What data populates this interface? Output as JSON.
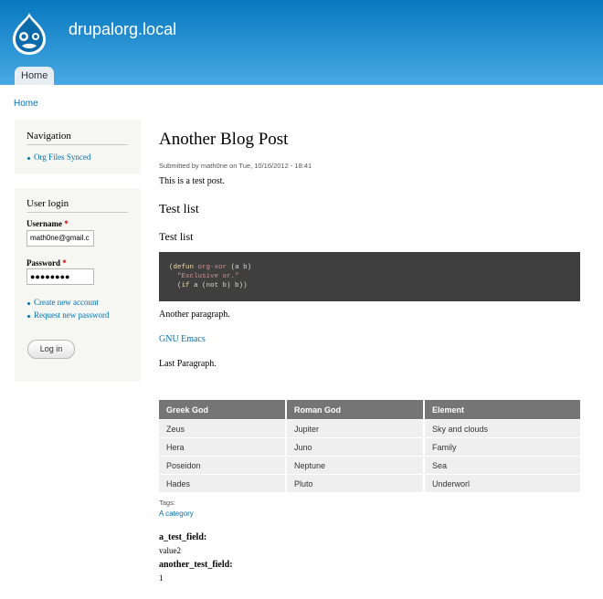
{
  "header": {
    "site_name": "drupalorg.local",
    "tab_home": "Home"
  },
  "breadcrumb": "Home",
  "sidebar": {
    "navigation": {
      "title": "Navigation",
      "items": [
        "Org Files Synced"
      ]
    },
    "login": {
      "title": "User login",
      "username_label": "Username",
      "username_value": "math0ne@gmail.c",
      "password_label": "Password",
      "password_value": "●●●●●●●●",
      "required_mark": "*",
      "links": [
        "Create new account",
        "Request new password"
      ],
      "button": "Log in"
    }
  },
  "post": {
    "title": "Another Blog Post",
    "submitted": "Submitted by math0ne on Tue, 10/16/2012 - 18:41",
    "intro": "This is a test post.",
    "h2": "Test list",
    "h3": "Test list",
    "code": {
      "l1_open": "(",
      "l1_defun": "defun",
      "l1_name": "org-xor",
      "l1_args": " (a b)",
      "l2_doc": "\"Exclusive or.\"",
      "l3_open": "(",
      "l3_if": "if",
      "l3_rest": " a (not b) b))"
    },
    "para2": "Another paragraph.",
    "link": "GNU Emacs",
    "last": "Last Paragraph.",
    "table": {
      "headers": [
        "Greek God",
        "Roman God",
        "Element"
      ],
      "rows": [
        [
          "Zeus",
          "Jupiter",
          "Sky and clouds"
        ],
        [
          "Hera",
          "Juno",
          "Family"
        ],
        [
          "Poseidon",
          "Neptune",
          "Sea"
        ],
        [
          "Hades",
          "Pluto",
          "Underworl"
        ]
      ]
    },
    "tags_label": "Tags:",
    "tags_link": "A category",
    "field1_label": "a_test_field:",
    "field1_value": "value2",
    "field2_label": "another_test_field:",
    "field2_value": "1"
  },
  "colors": {
    "header_top": "#0779bf",
    "header_bottom": "#48a9e4",
    "link": "#0071b3",
    "code_bg": "#3f3f3f",
    "table_header": "#757575"
  }
}
